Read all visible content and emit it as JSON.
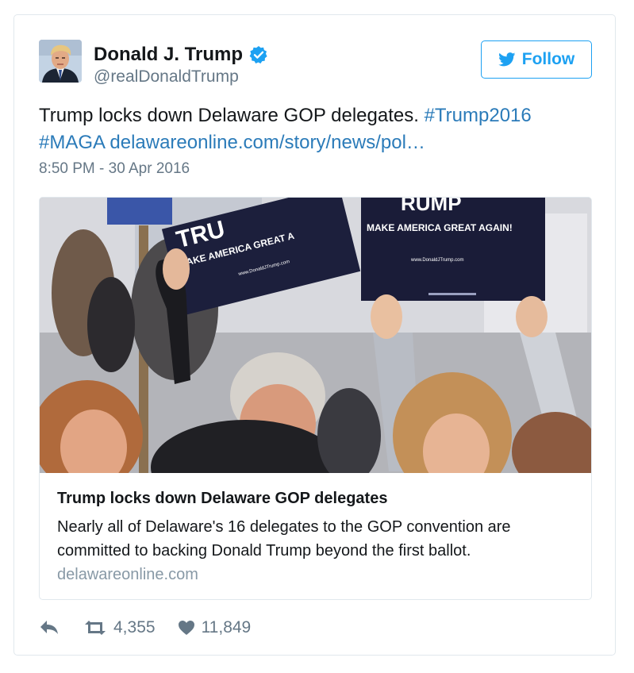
{
  "author": {
    "name": "Donald J. Trump",
    "handle": "@realDonaldTrump"
  },
  "follow_label": "Follow",
  "tweet": {
    "text": "Trump locks down Delaware GOP delegates.",
    "hashtag1": "#Trump2016",
    "hashtag2": "#MAGA",
    "url": "delawareonline.com/story/news/pol…",
    "timestamp": "8:50 PM - 30 Apr 2016"
  },
  "card": {
    "image_signs": {
      "sign1_top": "TRU",
      "sign1_slogan": "MAKE AMERICA GREAT A",
      "sign1_url": "www.DonaldJTrump.com",
      "sign2_top": "RUMP",
      "sign2_slogan": "MAKE AMERICA GREAT AGAIN!",
      "sign2_url": "www.DonaldJTrump.com"
    },
    "title": "Trump locks down Delaware GOP delegates",
    "description": "Nearly all of Delaware's 16 delegates to the GOP convention are committed to backing Donald Trump beyond the first ballot.",
    "domain": "delawareonline.com"
  },
  "actions": {
    "retweets": "4,355",
    "likes": "11,849"
  },
  "icons": {
    "verified": "verified-badge-icon",
    "follow": "twitter-bird-icon",
    "reply": "reply-icon",
    "retweet": "retweet-icon",
    "like": "heart-icon"
  },
  "colors": {
    "accent": "#1da1f2",
    "link": "#2b7bb9",
    "secondary_text": "#657786",
    "border": "#e1e8ed"
  }
}
